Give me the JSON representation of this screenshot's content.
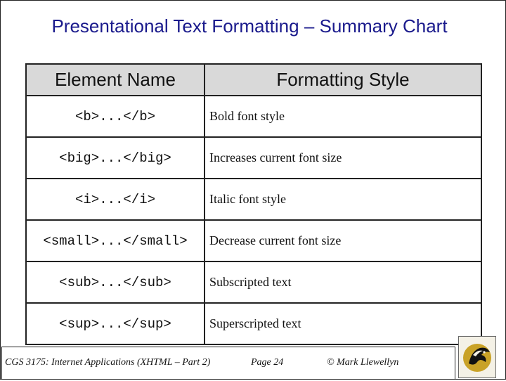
{
  "slide": {
    "title": "Presentational Text Formatting – Summary Chart"
  },
  "table": {
    "headers": {
      "element": "Element Name",
      "style": "Formatting Style"
    },
    "rows": [
      {
        "element": "<b>...</b>",
        "style": "Bold font style"
      },
      {
        "element": "<big>...</big>",
        "style": "Increases current font size"
      },
      {
        "element": "<i>...</i>",
        "style": "Italic font style"
      },
      {
        "element": "<small>...</small>",
        "style": "Decrease current font size"
      },
      {
        "element": "<sub>...</sub>",
        "style": "Subscripted text"
      },
      {
        "element": "<sup>...</sup>",
        "style": "Superscripted text"
      }
    ]
  },
  "footer": {
    "course": "CGS 3175: Internet Applications (XHTML – Part 2)",
    "page": "Page 24",
    "author": "© Mark Llewellyn"
  },
  "logo": {
    "icon": "ucf-pegasus-logo-icon",
    "colors": {
      "gold": "#c9a227",
      "black": "#111111"
    }
  }
}
